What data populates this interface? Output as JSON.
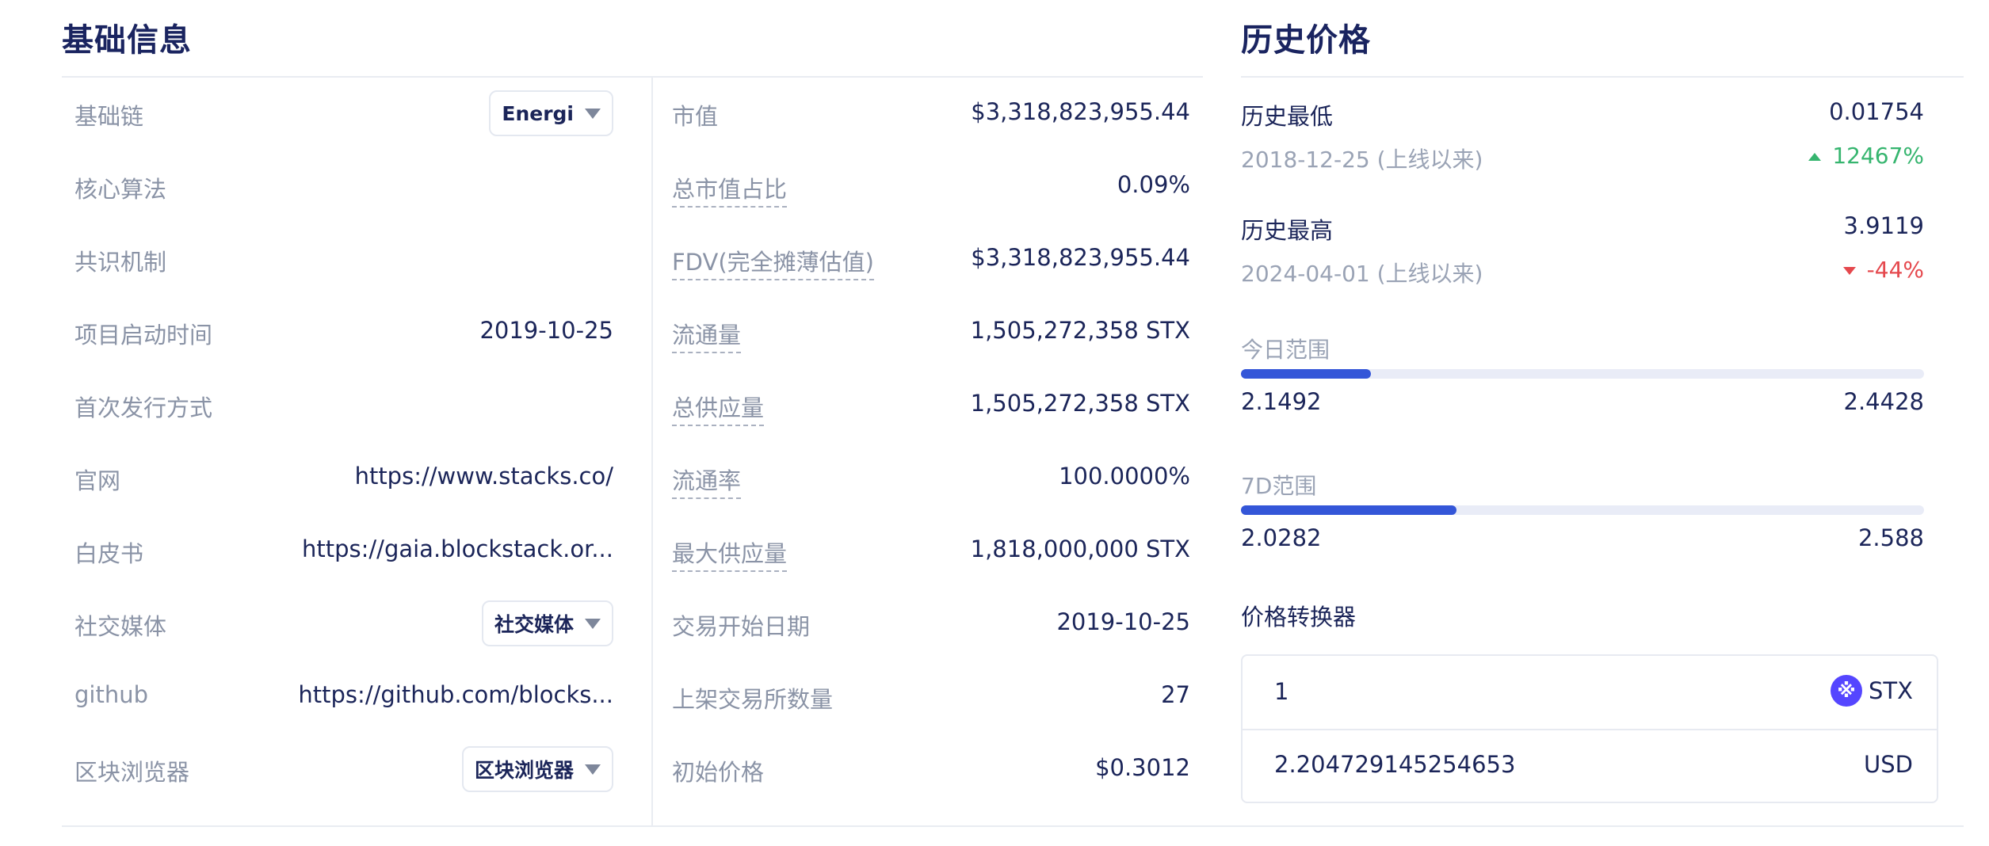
{
  "basic": {
    "title": "基础信息",
    "rows": [
      {
        "label": "基础链",
        "dropdown": "Energi"
      },
      {
        "label": "核心算法",
        "value": ""
      },
      {
        "label": "共识机制",
        "value": ""
      },
      {
        "label": "项目启动时间",
        "value": "2019-10-25"
      },
      {
        "label": "首次发行方式",
        "value": ""
      },
      {
        "label": "官网",
        "value": "https://www.stacks.co/"
      },
      {
        "label": "白皮书",
        "value": "https://gaia.blockstack.or..."
      },
      {
        "label": "社交媒体",
        "dropdown": "社交媒体"
      },
      {
        "label": "github",
        "value": "https://github.com/blocks..."
      },
      {
        "label": "区块浏览器",
        "dropdown": "区块浏览器"
      }
    ]
  },
  "market": {
    "rows": [
      {
        "label": "市值",
        "value": "$3,318,823,955.44"
      },
      {
        "label": "总市值占比",
        "value": "0.09%"
      },
      {
        "label": "FDV(完全摊薄估值)",
        "value": "$3,318,823,955.44"
      },
      {
        "label": "流通量",
        "value": "1,505,272,358 STX"
      },
      {
        "label": "总供应量",
        "value": "1,505,272,358 STX"
      },
      {
        "label": "流通率",
        "value": "100.0000%"
      },
      {
        "label": "最大供应量",
        "value": "1,818,000,000 STX"
      },
      {
        "label": "交易开始日期",
        "value": "2019-10-25"
      },
      {
        "label": "上架交易所数量",
        "value": "27"
      },
      {
        "label": "初始价格",
        "value": "$0.3012"
      }
    ]
  },
  "history": {
    "title": "历史价格",
    "low": {
      "label": "历史最低",
      "value": "0.01754",
      "date": "2018-12-25 (上线以来)",
      "change": "12467%",
      "change_color": "#36b56f"
    },
    "high": {
      "label": "历史最高",
      "value": "3.9119",
      "date": "2024-04-01 (上线以来)",
      "change": "-44%",
      "change_color": "#e5484d"
    },
    "today": {
      "label": "今日范围",
      "min": "2.1492",
      "max": "2.4428",
      "fill_fraction": 0.19
    },
    "week": {
      "label": "7D范围",
      "min": "2.0282",
      "max": "2.588",
      "fill_fraction": 0.315
    },
    "converter": {
      "label": "价格转换器",
      "from_amount": "1",
      "from_symbol": "STX",
      "to_amount": "2.204729145254653",
      "to_symbol": "USD",
      "accent": "#5546ff"
    }
  }
}
